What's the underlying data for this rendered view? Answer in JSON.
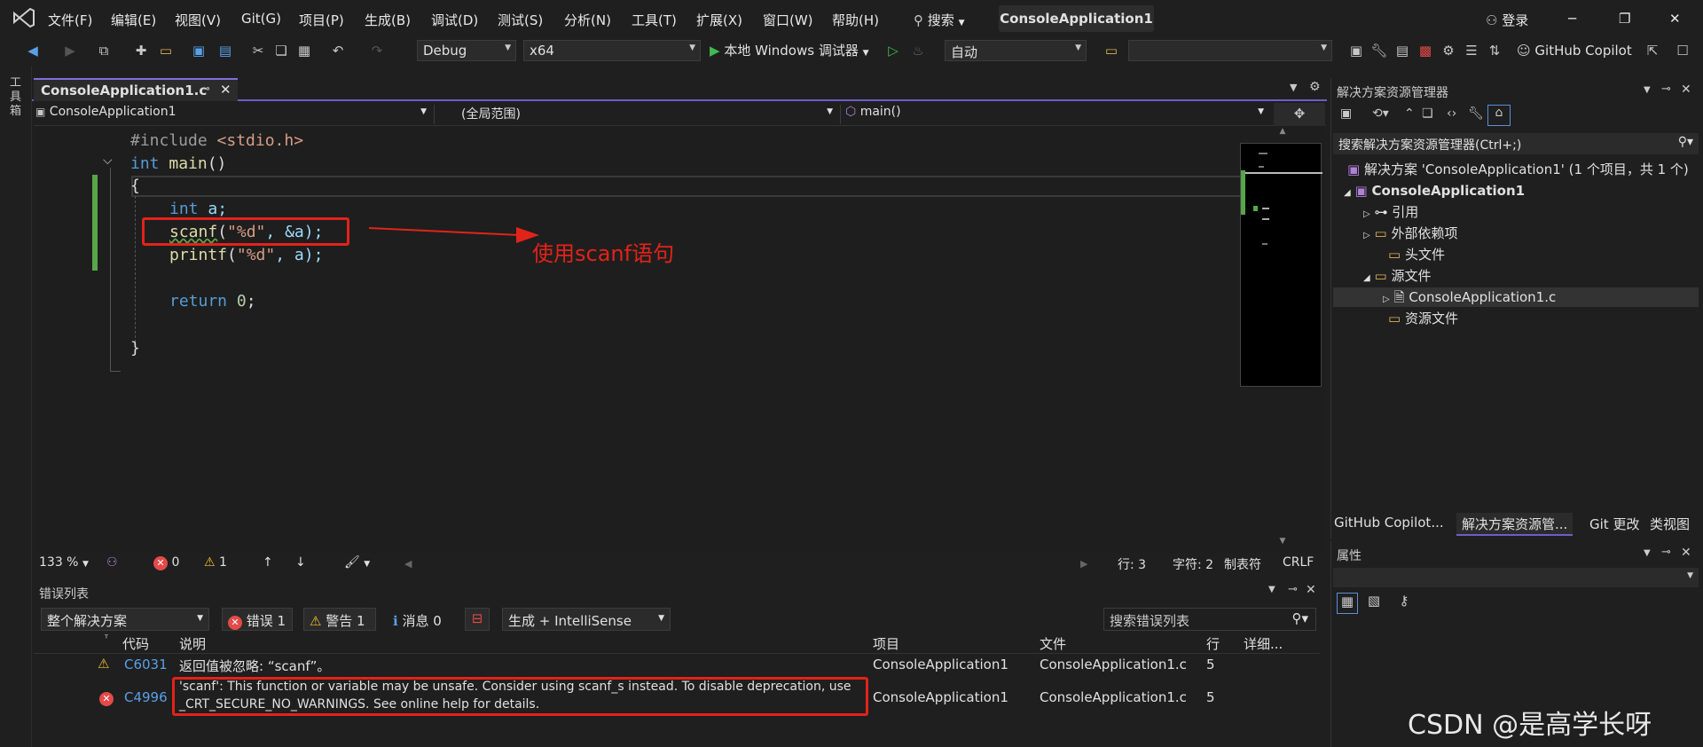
{
  "menubar": {
    "items": [
      "文件(F)",
      "编辑(E)",
      "视图(V)",
      "Git(G)",
      "项目(P)",
      "生成(B)",
      "调试(D)",
      "测试(S)",
      "分析(N)",
      "工具(T)",
      "扩展(X)",
      "窗口(W)",
      "帮助(H)"
    ],
    "search_label": "搜索",
    "solution_title": "ConsoleApplication1",
    "login_label": "登录"
  },
  "toolbar": {
    "config": "Debug",
    "platform": "x64",
    "debugger_label": "本地 Windows 调试器",
    "auto_label": "自动",
    "copilot_label": "GitHub Copilot"
  },
  "left_strip": {
    "label": "工具箱"
  },
  "editor": {
    "tab_label": "ConsoleApplication1.c",
    "nav_project": "ConsoleApplication1",
    "nav_scope": "(全局范围)",
    "nav_member": "main()",
    "lines": {
      "l1_pp": "#include",
      "l1_inc": " <stdio.h>",
      "l2_kw": "int",
      "l2_fn": " main",
      "l2_rest": "()",
      "l3": "{",
      "l4_kw": "int",
      "l4_rest": " a;",
      "l5_fn": "scanf",
      "l5_p": "(",
      "l5_str": "\"%d\"",
      "l5_rest": ", &a);",
      "l6_fn": "printf",
      "l6_p": "(",
      "l6_str": "\"%d\"",
      "l6_rest": ", a);",
      "l8_kw": "return",
      "l8_num": " 0",
      "l8_rest": ";",
      "l10": "}"
    },
    "annotation": "使用scanf语句"
  },
  "status_strip": {
    "zoom": "133 %",
    "errors": "0",
    "warnings": "1",
    "line": "行: 3",
    "char": "字符: 2",
    "tabs": "制表符",
    "eol": "CRLF"
  },
  "error_list": {
    "title": "错误列表",
    "scope": "整个解决方案",
    "errors_btn": "错误 1",
    "warnings_btn": "警告 1",
    "messages_btn": "消息 0",
    "build_filter": "生成 + IntelliSense",
    "search_placeholder": "搜索错误列表",
    "headers": {
      "code": "代码",
      "desc": "说明",
      "project": "项目",
      "file": "文件",
      "line": "行",
      "detail": "详细..."
    },
    "rows": [
      {
        "code": "C6031",
        "desc": "返回值被忽略: “scanf”。",
        "project": "ConsoleApplication1",
        "file": "ConsoleApplication1.c",
        "line": "5"
      },
      {
        "code": "C4996",
        "desc1": "'scanf': This function or variable may be unsafe. Consider using scanf_s instead. To disable deprecation, use",
        "desc2": "_CRT_SECURE_NO_WARNINGS. See online help for details.",
        "project": "ConsoleApplication1",
        "file": "ConsoleApplication1.c",
        "line": "5"
      }
    ]
  },
  "solution_explorer": {
    "title": "解决方案资源管理器",
    "search_placeholder": "搜索解决方案资源管理器(Ctrl+;)",
    "solution": "解决方案 'ConsoleApplication1' (1 个项目，共 1 个)",
    "project": "ConsoleApplication1",
    "references": "引用",
    "external_deps": "外部依赖项",
    "header_files": "头文件",
    "source_files": "源文件",
    "source_file": "ConsoleApplication1.c",
    "resource_files": "资源文件"
  },
  "bottom_tabs": [
    "GitHub Copilot...",
    "解决方案资源管...",
    "Git 更改",
    "类视图"
  ],
  "properties": {
    "title": "属性"
  },
  "watermark": "CSDN @是高学长呀",
  "colors": {
    "accent": "#6f5cc4",
    "error": "#e34a48",
    "warning": "#f2c12e",
    "annotation": "#e2231a"
  }
}
